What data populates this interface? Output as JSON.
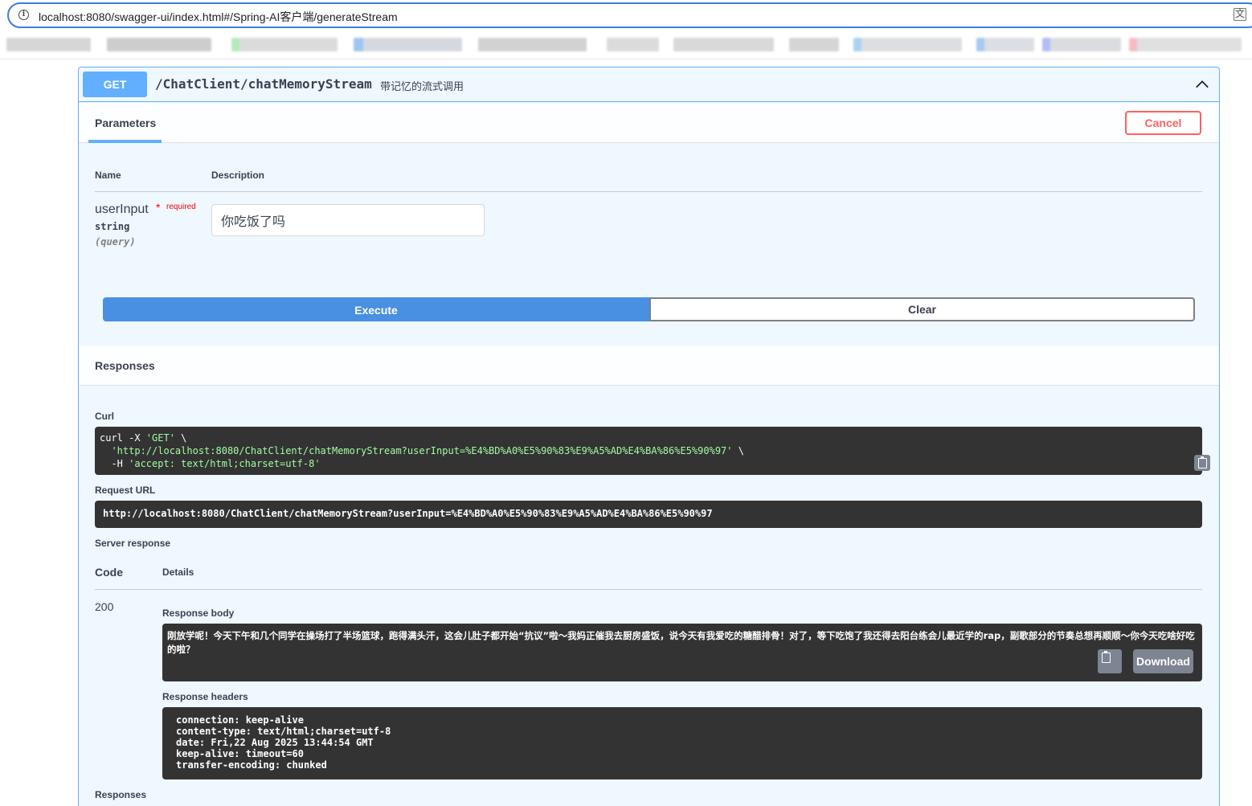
{
  "browser": {
    "url": "localhost:8080/swagger-ui/index.html#/Spring-AI客户端/generateStream"
  },
  "colors": {
    "get_method": "#61affe",
    "execute": "#4990e2",
    "cancel": "#ff6060",
    "code_bg": "#333333"
  },
  "operation": {
    "method": "GET",
    "path": "/ChatClient/chatMemoryStream",
    "summary": "带记忆的流式调用",
    "chevron_icon": "chevron-up-icon"
  },
  "parameters": {
    "tab_label": "Parameters",
    "cancel_label": "Cancel",
    "col_name": "Name",
    "col_description": "Description",
    "items": [
      {
        "name": "userInput",
        "required_mark": "*",
        "required_label": "required",
        "type": "string",
        "in": "(query)",
        "value": "你吃饭了吗"
      }
    ]
  },
  "actions": {
    "execute_label": "Execute",
    "clear_label": "Clear"
  },
  "responses": {
    "title": "Responses",
    "curl_label": "Curl",
    "curl_line1": "curl -X ",
    "curl_method": "'GET'",
    "curl_line1_end": " \\",
    "curl_url": "'http://localhost:8080/ChatClient/chatMemoryStream?userInput=%E4%BD%A0%E5%90%83%E9%A5%AD%E4%BA%86%E5%90%97'",
    "curl_line2_end": " \\",
    "curl_header_flag": "  -H ",
    "curl_header": "'accept: text/html;charset=utf-8'",
    "request_url_label": "Request URL",
    "request_url": "http://localhost:8080/ChatClient/chatMemoryStream?userInput=%E4%BD%A0%E5%90%83%E9%A5%AD%E4%BA%86%E5%90%97",
    "server_response_label": "Server response",
    "code_col": "Code",
    "details_col": "Details",
    "status": "200",
    "response_body_label": "Response body",
    "response_body": "刚放学呢！今天下午和几个同学在操场打了半场篮球，跑得满头汗，这会儿肚子都开始“抗议”啦～我妈正催我去厨房盛饭，说今天有我爱吃的糖醋排骨！对了，等下吃饱了我还得去阳台练会儿最近学的rap，副歌部分的节奏总想再顺顺～你今天吃啥好吃的啦？",
    "download_label": "Download",
    "response_headers_label": "Response headers",
    "response_headers": "connection: keep-alive\ncontent-type: text/html;charset=utf-8\ndate: Fri,22 Aug 2025 13:44:54 GMT\nkeep-alive: timeout=60\ntransfer-encoding: chunked",
    "footer_label": "Responses"
  }
}
